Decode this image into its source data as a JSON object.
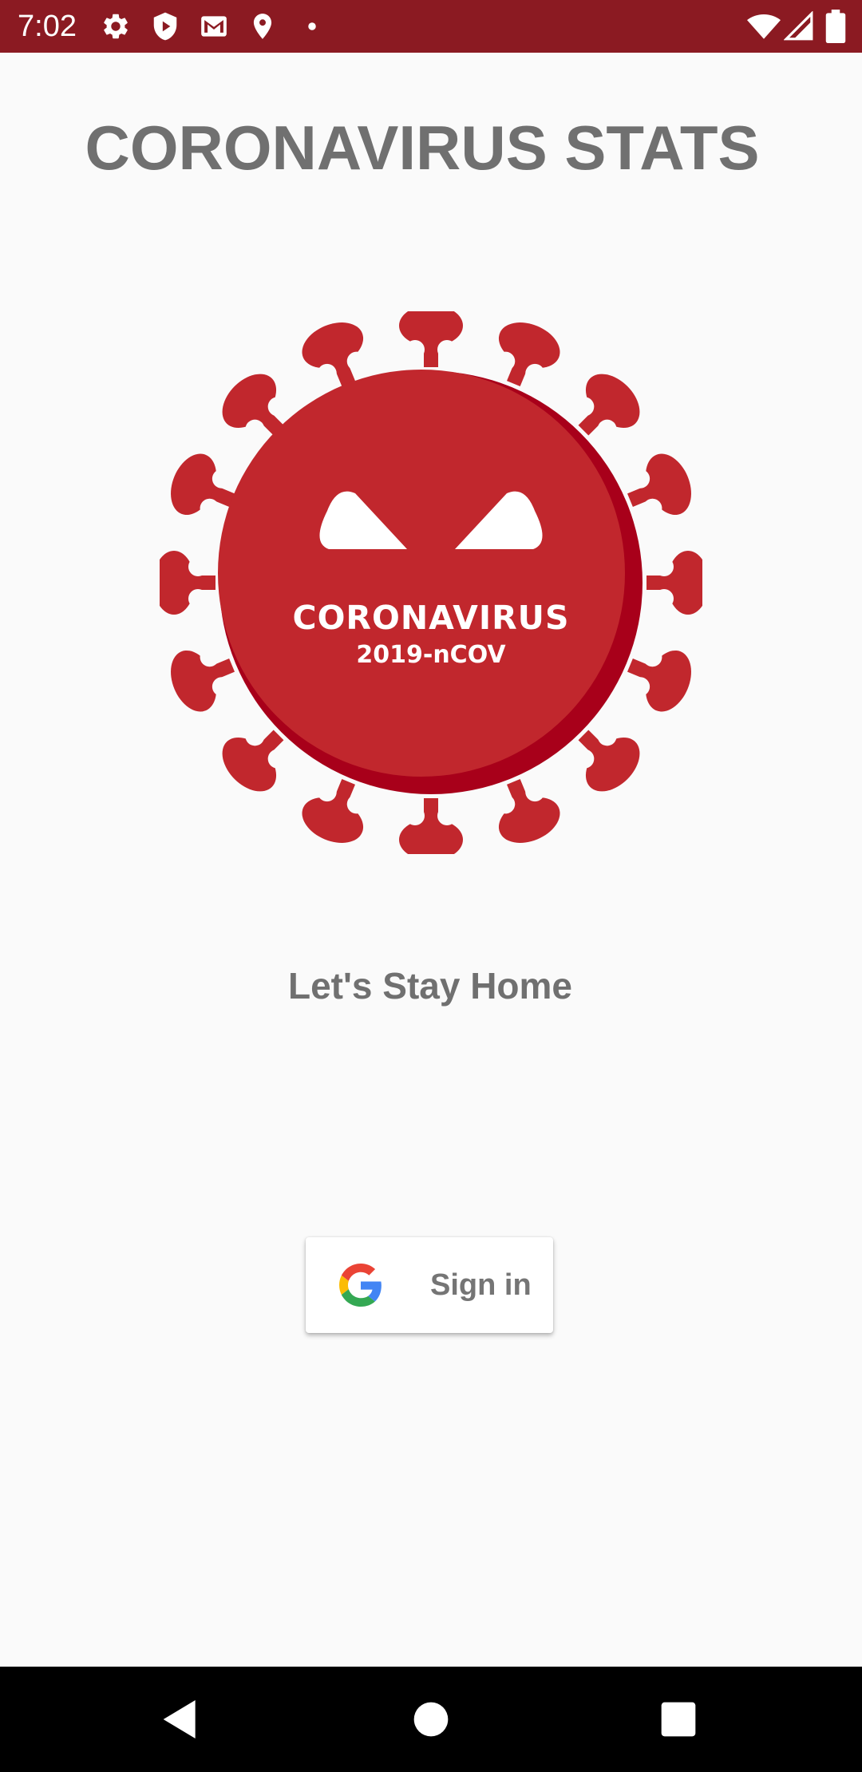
{
  "status_bar": {
    "time": "7:02",
    "background_color": "#8b1a22",
    "left_icons": [
      "settings-icon",
      "play-protect-icon",
      "gmail-icon",
      "location-icon",
      "notification-dot-icon"
    ],
    "right_icons": [
      "wifi-icon",
      "cellular-signal-icon",
      "battery-icon"
    ]
  },
  "main": {
    "title": "CORONAVIRUS STATS",
    "logo": {
      "line1": "CORONAVIRUS",
      "line2": "2019-nCOV",
      "color": "#c1272d",
      "shadow_color": "#a8001a"
    },
    "tagline": "Let's Stay Home",
    "signin_button": {
      "label": "Sign in",
      "icon": "google-g-icon"
    },
    "text_color": "#707070"
  },
  "nav_bar": {
    "buttons": [
      "back-icon",
      "home-icon",
      "recents-icon"
    ]
  }
}
